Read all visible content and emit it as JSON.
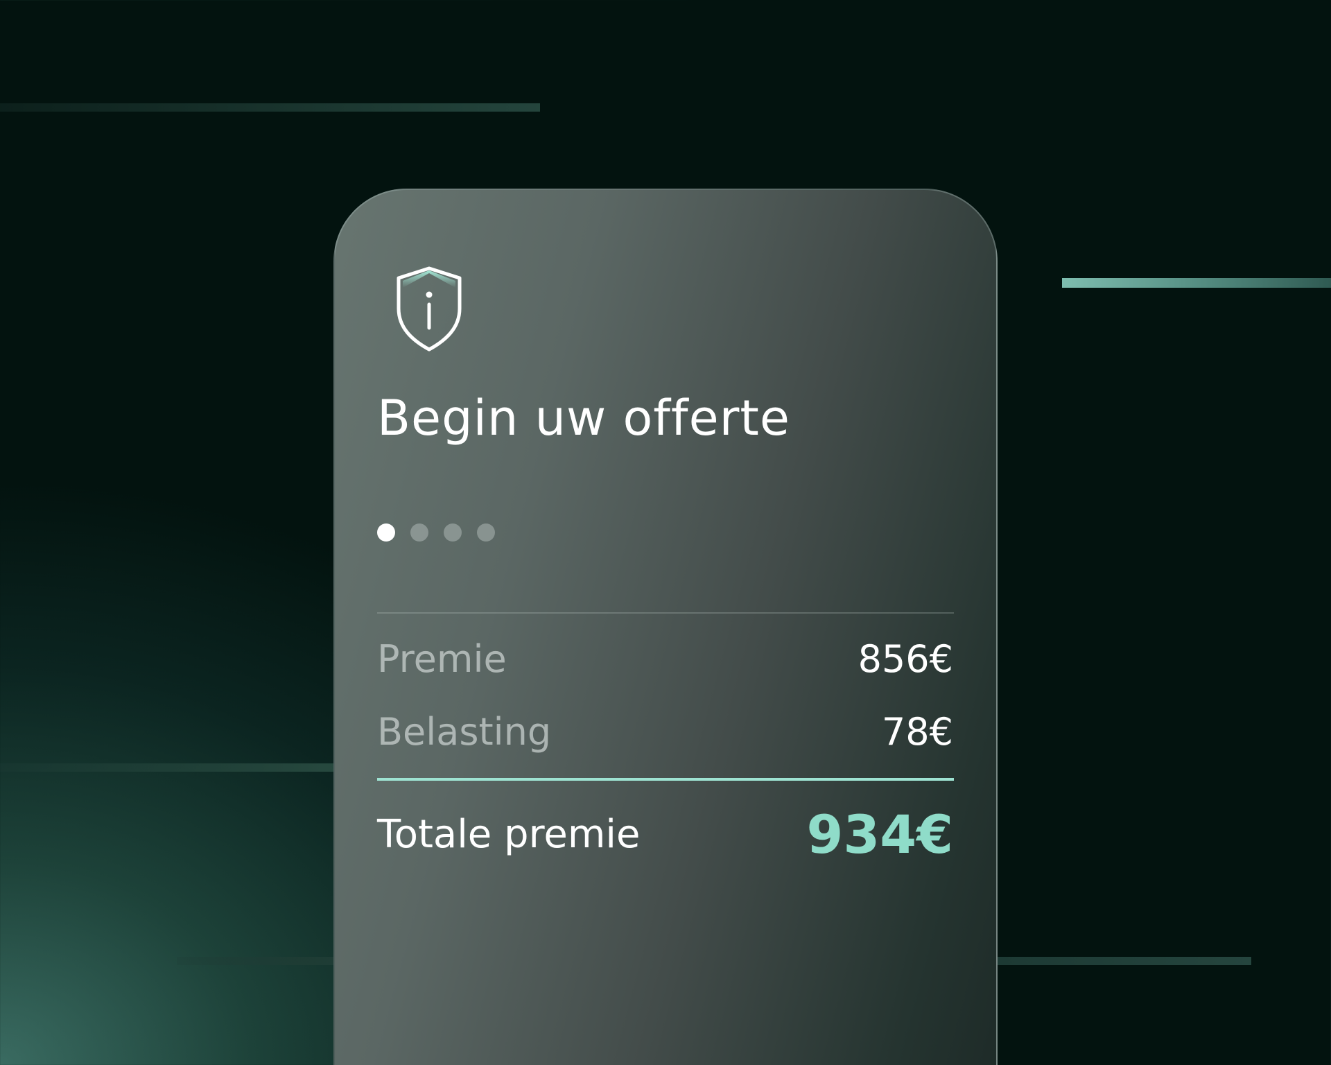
{
  "card": {
    "title": "Begin uw offerte",
    "icon": "shield-info-icon",
    "steps": {
      "total": 4,
      "current": 1
    },
    "rows": [
      {
        "label": "Premie",
        "value": "856€"
      },
      {
        "label": "Belasting",
        "value": "78€"
      }
    ],
    "total": {
      "label": "Totale premie",
      "value": "934€"
    }
  },
  "colors": {
    "background": "#03130f",
    "accent": "#8fdcc9",
    "accent_line": "#9ee3d2",
    "text_primary": "#ffffff"
  }
}
